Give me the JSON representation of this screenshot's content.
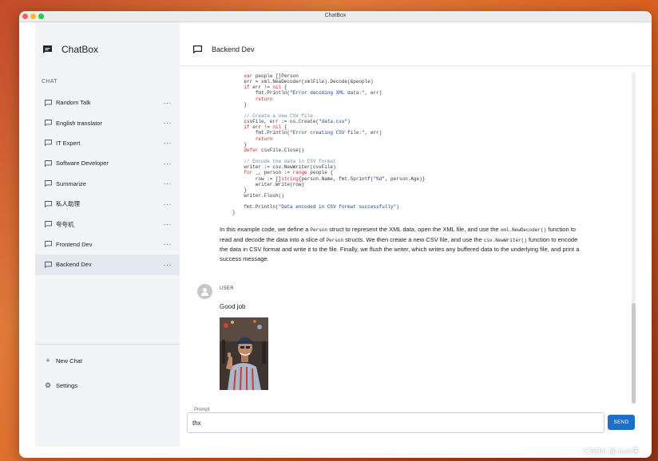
{
  "window": {
    "title": "ChatBox"
  },
  "sidebar": {
    "brand": "ChatBox",
    "section_label": "CHAT",
    "items": [
      {
        "label": "Random Talk",
        "active": false
      },
      {
        "label": "English translator",
        "active": false
      },
      {
        "label": "IT Expert",
        "active": false
      },
      {
        "label": "Software Developer",
        "active": false
      },
      {
        "label": "Summarize",
        "active": false
      },
      {
        "label": "私人助理",
        "active": false
      },
      {
        "label": "夸夸机",
        "active": false
      },
      {
        "label": "Frontend Dev",
        "active": false
      },
      {
        "label": "Backend Dev",
        "active": true
      }
    ],
    "more_label": "···",
    "new_chat": "New Chat",
    "settings": "Settings"
  },
  "main": {
    "title": "Backend Dev",
    "code_lines": [
      [
        {
          "t": "    "
        },
        {
          "t": "var",
          "c": "kw"
        },
        {
          "t": " people []Person"
        }
      ],
      [
        {
          "t": "    err = xml.NewDecoder(xmlFile).Decode(&people)"
        }
      ],
      [
        {
          "t": "    "
        },
        {
          "t": "if",
          "c": "kw"
        },
        {
          "t": " err != "
        },
        {
          "t": "nil",
          "c": "kw"
        },
        {
          "t": " {"
        }
      ],
      [
        {
          "t": "        fmt.Println("
        },
        {
          "t": "\"Error decoding XML data:\"",
          "c": "st"
        },
        {
          "t": ", err)"
        }
      ],
      [
        {
          "t": "        "
        },
        {
          "t": "return",
          "c": "kw"
        }
      ],
      [
        {
          "t": "    }"
        }
      ],
      [
        {
          "t": ""
        }
      ],
      [
        {
          "t": "    "
        },
        {
          "t": "// Create a new CSV file",
          "c": "cm"
        }
      ],
      [
        {
          "t": "    csvFile, err := os.Create("
        },
        {
          "t": "\"data.csv\"",
          "c": "st"
        },
        {
          "t": ")"
        }
      ],
      [
        {
          "t": "    "
        },
        {
          "t": "if",
          "c": "kw"
        },
        {
          "t": " err != "
        },
        {
          "t": "nil",
          "c": "kw"
        },
        {
          "t": " {"
        }
      ],
      [
        {
          "t": "        fmt.Println("
        },
        {
          "t": "\"Error creating CSV file:\"",
          "c": "st"
        },
        {
          "t": ", err)"
        }
      ],
      [
        {
          "t": "        "
        },
        {
          "t": "return",
          "c": "kw"
        }
      ],
      [
        {
          "t": "    }"
        }
      ],
      [
        {
          "t": "    "
        },
        {
          "t": "defer",
          "c": "kw"
        },
        {
          "t": " csvFile.Close()"
        }
      ],
      [
        {
          "t": ""
        }
      ],
      [
        {
          "t": "    "
        },
        {
          "t": "// Encode the data in CSV format",
          "c": "cm"
        }
      ],
      [
        {
          "t": "    writer := csv.NewWriter(csvFile)"
        }
      ],
      [
        {
          "t": "    "
        },
        {
          "t": "for",
          "c": "kw"
        },
        {
          "t": " _, person := "
        },
        {
          "t": "range",
          "c": "kw"
        },
        {
          "t": " people {"
        }
      ],
      [
        {
          "t": "        row := []"
        },
        {
          "t": "string",
          "c": "kw"
        },
        {
          "t": "{person.Name, fmt.Sprintf("
        },
        {
          "t": "\"%d\"",
          "c": "st"
        },
        {
          "t": ", person.Age)}"
        }
      ],
      [
        {
          "t": "        writer.Write(row)"
        }
      ],
      [
        {
          "t": "    }"
        }
      ],
      [
        {
          "t": "    writer.Flush()"
        }
      ],
      [
        {
          "t": ""
        }
      ],
      [
        {
          "t": "    fmt.Println("
        },
        {
          "t": "\"Data encoded in CSV format successfully\"",
          "c": "st"
        },
        {
          "t": ")"
        }
      ],
      [
        {
          "t": "}"
        }
      ]
    ],
    "paragraph": [
      {
        "t": "In this example code, we define a "
      },
      {
        "t": "Person",
        "m": true
      },
      {
        "t": " struct to represent the XML data, open the XML file, and use the "
      },
      {
        "t": "xml.NewDecoder()",
        "m": true
      },
      {
        "t": " function to read and decode the data into a slice of "
      },
      {
        "t": "Person",
        "m": true
      },
      {
        "t": " structs. We then create a new CSV file, and use the "
      },
      {
        "t": "csv.NewWriter()",
        "m": true
      },
      {
        "t": " function to encode the data in CSV format and write it to the file. Finally, we flush the writer, which writes any buffered data to the underlying file, and print a success message."
      }
    ],
    "user_role": "USER",
    "user_message": "Good job",
    "prompt_label": "Prompt",
    "prompt_value": "thx",
    "send_label": "SEND"
  },
  "watermark": "CSDN @Jum朱"
}
